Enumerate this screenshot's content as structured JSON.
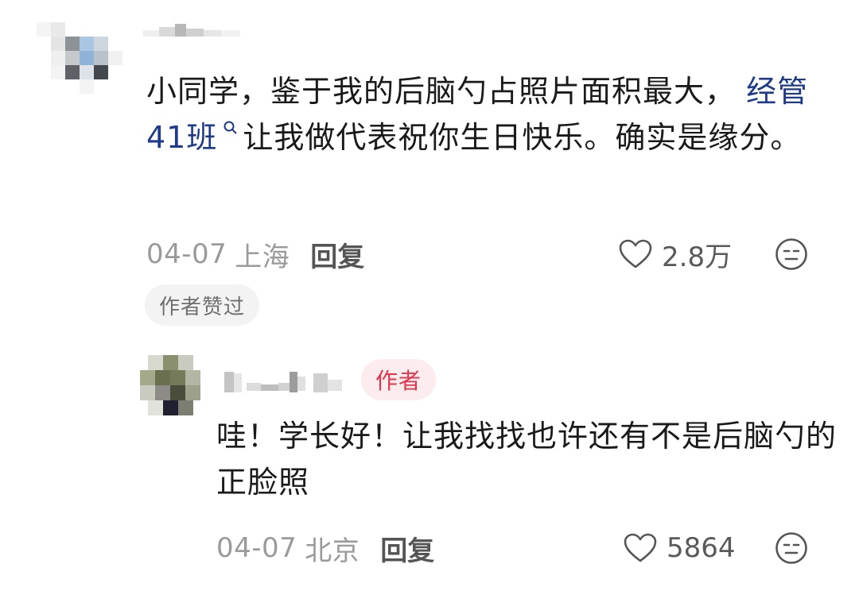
{
  "comment": {
    "text_before_topic": "小同学，鉴于我的后脑勺占照片面积最大，",
    "topic_text": "经管41班",
    "text_after_topic": "让我做代表祝你生日快乐。确实是缘分。",
    "date": "04-07",
    "location": "上海",
    "reply_label": "回复",
    "like_count": "2.8万",
    "author_liked_label": "作者赞过"
  },
  "reply": {
    "author_badge": "作者",
    "text": "哇！学长好！让我找找也许还有不是后脑勺的正脸照",
    "date": "04-07",
    "location": "北京",
    "reply_label": "回复",
    "like_count": "5864"
  },
  "colors": {
    "topic_link": "#1e3a8a",
    "author_badge_text": "#e4334c",
    "author_badge_bg": "#fdecee",
    "meta_gray": "#9a9a9a"
  },
  "icons": {
    "like": "heart-outline-icon",
    "emoji": "meh-face-icon",
    "topic": "search-icon"
  }
}
